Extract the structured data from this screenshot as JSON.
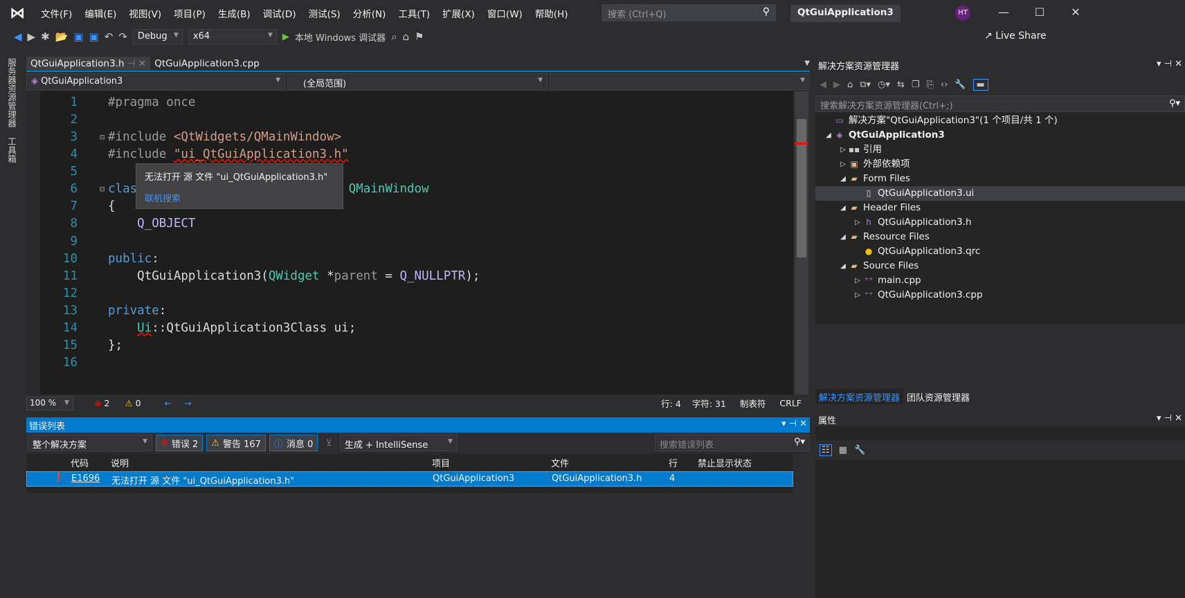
{
  "menubar": {
    "items": [
      "文件(F)",
      "编辑(E)",
      "视图(V)",
      "项目(P)",
      "生成(B)",
      "调试(D)",
      "测试(S)",
      "分析(N)",
      "工具(T)",
      "扩展(X)",
      "窗口(W)",
      "帮助(H)"
    ],
    "search_placeholder": "搜索 (Ctrl+Q)",
    "solution_title": "QtGuiApplication3",
    "avatar": "HT"
  },
  "toolbar": {
    "config": "Debug",
    "platform": "x64",
    "run_label": "本地 Windows 调试器",
    "live_share": "Live Share"
  },
  "side_tabs": [
    "服务器资源管理器",
    "工具箱"
  ],
  "doc_tabs": [
    {
      "label": "QtGuiApplication3.h",
      "active": true
    },
    {
      "label": "QtGuiApplication3.cpp",
      "active": false
    }
  ],
  "nav": {
    "project": "QtGuiApplication3",
    "scope": "(全局范围)",
    "member": ""
  },
  "code": [
    [
      [
        "pp",
        "#pragma once"
      ]
    ],
    [],
    [
      [
        "pp",
        "#include "
      ],
      [
        "s",
        "<QtWidgets/QMainWindow>"
      ]
    ],
    [
      [
        "pp",
        "#include "
      ],
      [
        "s sq",
        "\"ui_QtGuiApplication3.h\""
      ]
    ],
    [],
    [
      [
        "k",
        "class "
      ],
      [
        "t",
        "QtGuiApplication3"
      ],
      [
        "d",
        " : "
      ],
      [
        "k",
        "public "
      ],
      [
        "t",
        "QMainWindow"
      ]
    ],
    [
      [
        "d",
        "{"
      ]
    ],
    [
      [
        "d",
        "    "
      ],
      [
        "m",
        "Q_OBJECT"
      ]
    ],
    [],
    [
      [
        "k",
        "public"
      ],
      [
        "d",
        ":"
      ]
    ],
    [
      [
        "d",
        "    "
      ],
      [
        "d",
        "QtGuiApplication3("
      ],
      [
        "t",
        "QWidget "
      ],
      [
        "d",
        "*"
      ],
      [
        "p",
        "parent"
      ],
      [
        "d",
        " = "
      ],
      [
        "m",
        "Q_NULLPTR"
      ],
      [
        "d",
        ");"
      ]
    ],
    [],
    [
      [
        "k",
        "private"
      ],
      [
        "d",
        ":"
      ]
    ],
    [
      [
        "d",
        "    "
      ],
      [
        "t sq",
        "Ui"
      ],
      [
        "d",
        "::"
      ],
      [
        "d",
        "QtGuiApplication3Class ui;"
      ]
    ],
    [
      [
        "d",
        "};"
      ]
    ],
    []
  ],
  "tooltip": {
    "message": "无法打开 源 文件 \"ui_QtGuiApplication3.h\"",
    "link": "联机搜索"
  },
  "editor_status": {
    "zoom": "100 %",
    "errors": "2",
    "warnings": "0",
    "line": "行: 4",
    "char": "字符: 31",
    "tabs": "制表符",
    "eol": "CRLF"
  },
  "error_list": {
    "title": "错误列表",
    "scope": "整个解决方案",
    "errors": "错误 2",
    "warnings": "警告 167",
    "messages": "消息 0",
    "source": "生成 + IntelliSense",
    "search_placeholder": "搜索错误列表",
    "columns": [
      "代码",
      "说明",
      "项目",
      "文件",
      "行",
      "禁止显示状态"
    ],
    "rows": [
      {
        "code": "E1696",
        "description": "无法打开 源 文件 \"ui_QtGuiApplication3.h\"",
        "project": "QtGuiApplication3",
        "file": "QtGuiApplication3.h",
        "line": "4",
        "suppression": ""
      }
    ]
  },
  "solution_explorer": {
    "title": "解决方案资源管理器",
    "search_placeholder": "搜索解决方案资源管理器(Ctrl+;)",
    "items": [
      {
        "label": "解决方案\"QtGuiApplication3\"(1 个项目/共 1 个)",
        "indent": 0,
        "arrow": "",
        "icon": "solution-icon"
      },
      {
        "label": "QtGuiApplication3",
        "indent": 0,
        "arrow": "◢",
        "icon": "project-icon",
        "bold": true
      },
      {
        "label": "引用",
        "indent": 1,
        "arrow": "▷",
        "icon": "references-icon"
      },
      {
        "label": "外部依赖项",
        "indent": 1,
        "arrow": "▷",
        "icon": "external-deps-icon"
      },
      {
        "label": "Form Files",
        "indent": 1,
        "arrow": "◢",
        "icon": "folder-icon"
      },
      {
        "label": "QtGuiApplication3.ui",
        "indent": 2,
        "arrow": "",
        "icon": "ui-file-icon",
        "selected": true
      },
      {
        "label": "Header Files",
        "indent": 1,
        "arrow": "◢",
        "icon": "folder-icon"
      },
      {
        "label": "QtGuiApplication3.h",
        "indent": 2,
        "arrow": "▷",
        "icon": "header-file-icon"
      },
      {
        "label": "Resource Files",
        "indent": 1,
        "arrow": "◢",
        "icon": "folder-icon"
      },
      {
        "label": "QtGuiApplication3.qrc",
        "indent": 2,
        "arrow": "",
        "icon": "qrc-file-icon"
      },
      {
        "label": "Source Files",
        "indent": 1,
        "arrow": "◢",
        "icon": "folder-icon"
      },
      {
        "label": "main.cpp",
        "indent": 2,
        "arrow": "▷",
        "icon": "cpp-file-icon"
      },
      {
        "label": "QtGuiApplication3.cpp",
        "indent": 2,
        "arrow": "▷",
        "icon": "cpp-file-icon"
      }
    ],
    "tabs": [
      "解决方案资源管理器",
      "团队资源管理器"
    ]
  },
  "properties": {
    "title": "属性"
  },
  "colors": {
    "accent": "#007acc",
    "error": "#e51400",
    "link": "#3794ff"
  }
}
